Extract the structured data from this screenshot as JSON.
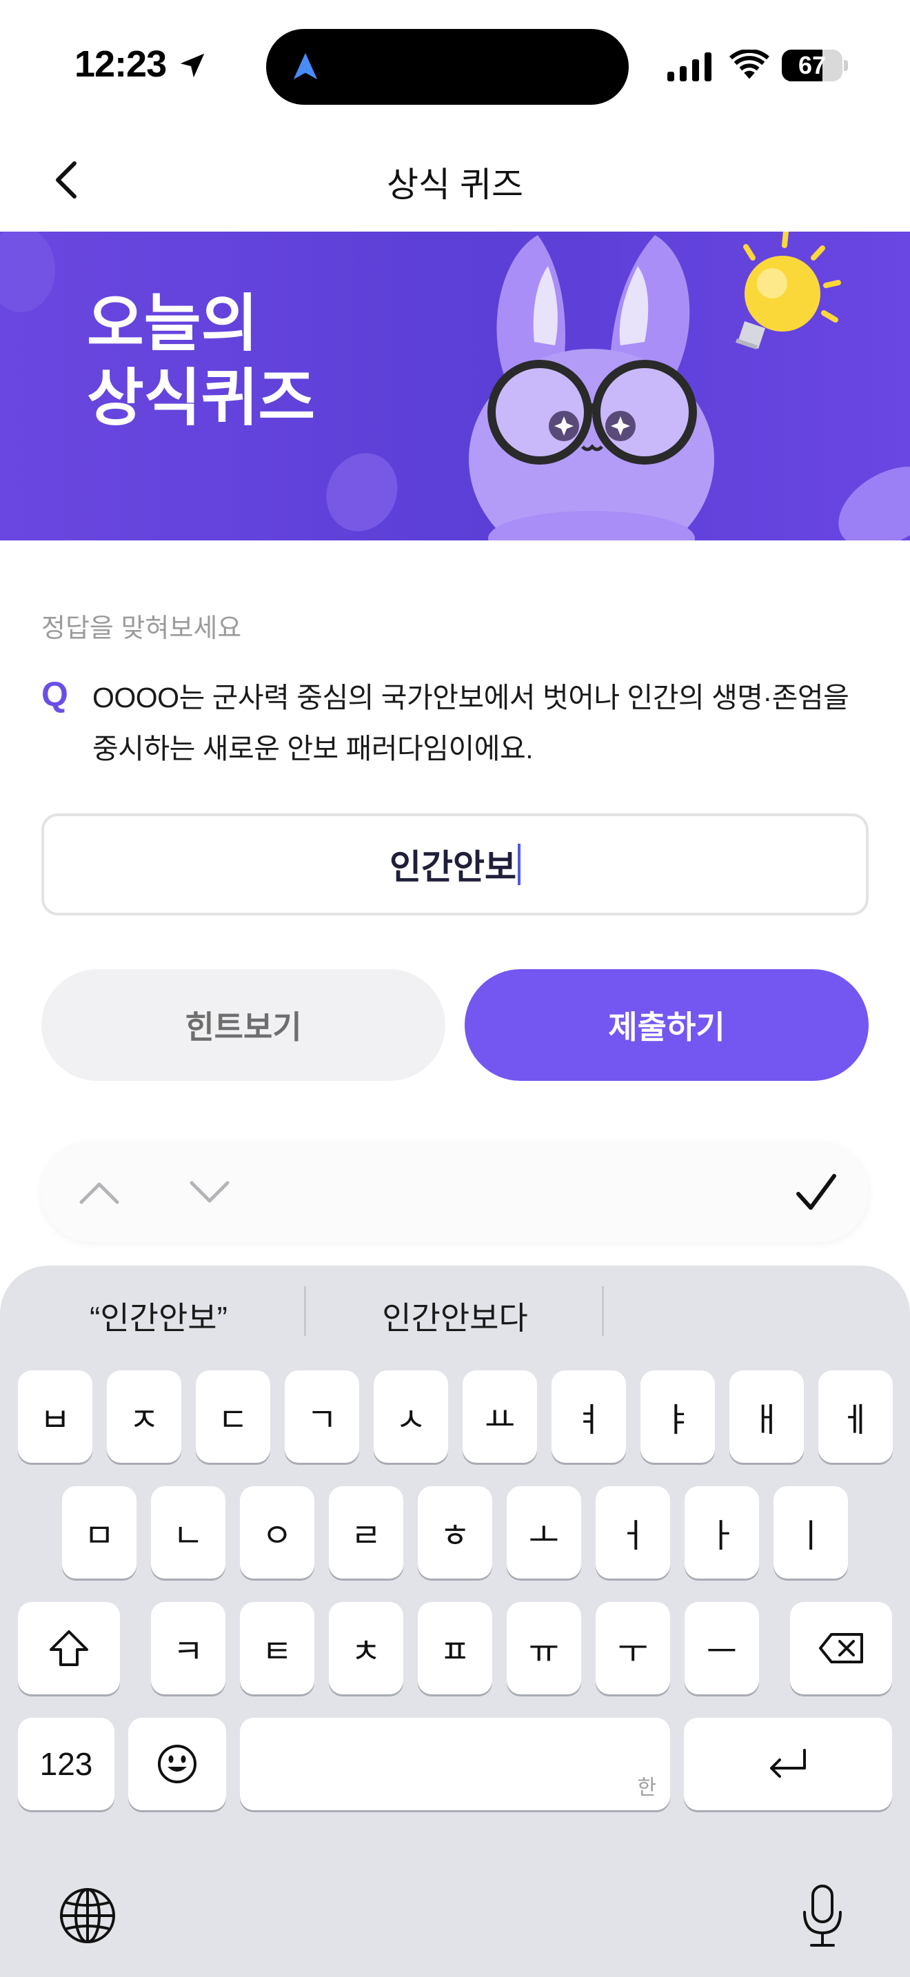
{
  "status": {
    "time": "12:23",
    "battery": "67",
    "battery_level": 0.67
  },
  "nav": {
    "title": "상식 퀴즈"
  },
  "banner": {
    "title_line1": "오늘의",
    "title_line2": "상식퀴즈"
  },
  "quiz": {
    "prompt": "정답을 맞혀보세요",
    "q_label": "Q",
    "question": "OOOO는 군사력 중심의 국가안보에서 벗어나 인간의 생명·존엄을 중시하는 새로운 안보 패러다임이에요.",
    "answer_value": "인간안보",
    "hint_label": "힌트보기",
    "submit_label": "제출하기"
  },
  "keyboard": {
    "suggestions": [
      "“인간안보”",
      "인간안보다"
    ],
    "row1": [
      "ㅂ",
      "ㅈ",
      "ㄷ",
      "ㄱ",
      "ㅅ",
      "ㅛ",
      "ㅕ",
      "ㅑ",
      "ㅐ",
      "ㅔ"
    ],
    "row2": [
      "ㅁ",
      "ㄴ",
      "ㅇ",
      "ㄹ",
      "ㅎ",
      "ㅗ",
      "ㅓ",
      "ㅏ",
      "ㅣ"
    ],
    "row3": [
      "ㅋ",
      "ㅌ",
      "ㅊ",
      "ㅍ",
      "ㅠ",
      "ㅜ",
      "ㅡ"
    ],
    "numbers_label": "123",
    "space_hint": "한"
  },
  "colors": {
    "accent": "#7456f0",
    "banner": "#5b3fd6"
  }
}
